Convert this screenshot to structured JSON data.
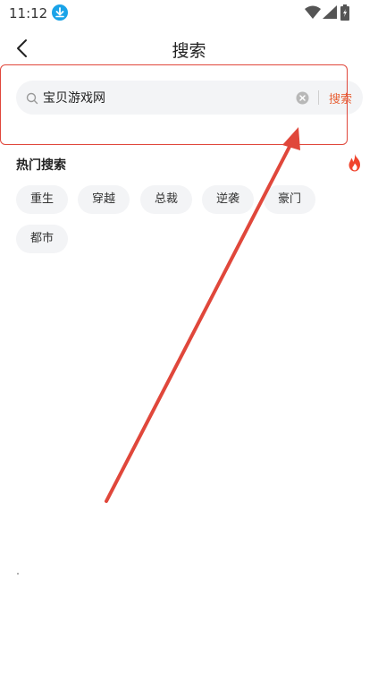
{
  "status_bar": {
    "time": "11:12",
    "download_icon": "download-icon",
    "wifi_icon": "wifi-icon",
    "signal_icon": "signal-icon",
    "battery_icon": "battery-icon"
  },
  "header": {
    "back_icon": "chevron-left-icon",
    "title": "搜索"
  },
  "search": {
    "value": "宝贝游戏网",
    "search_icon": "search-icon",
    "clear_icon": "clear-icon",
    "button_label": "搜索"
  },
  "hot_search": {
    "title": "热门搜索",
    "icon": "fire-icon",
    "tags": [
      "重生",
      "穿越",
      "总裁",
      "逆袭",
      "豪门",
      "都市"
    ]
  },
  "colors": {
    "accent": "#e8643a",
    "annotation": "#e0473b",
    "tag_bg": "#f3f4f6"
  }
}
